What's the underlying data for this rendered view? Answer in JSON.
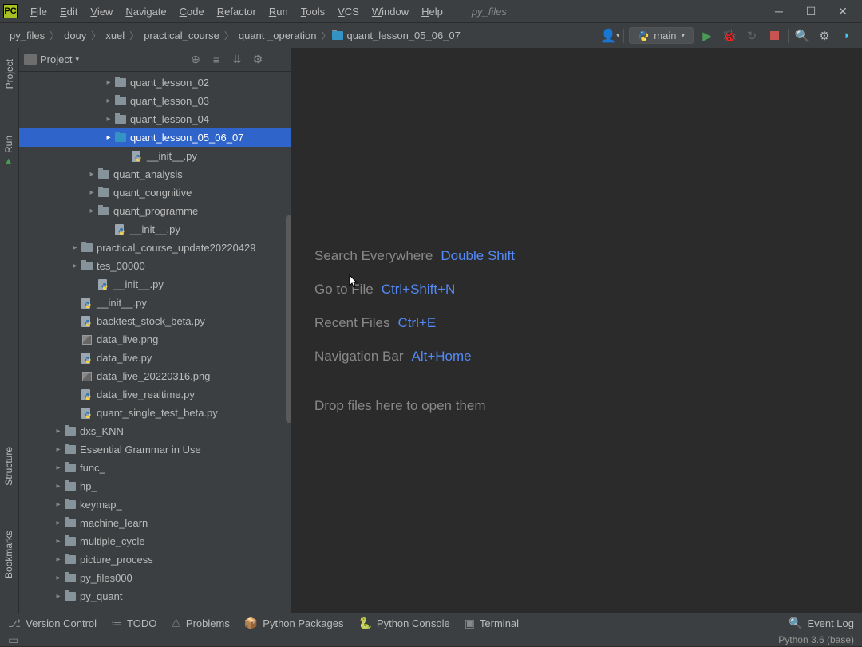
{
  "menus": [
    "File",
    "Edit",
    "View",
    "Navigate",
    "Code",
    "Refactor",
    "Run",
    "Tools",
    "VCS",
    "Window",
    "Help"
  ],
  "projectName": "py_files",
  "breadcrumb": [
    "py_files",
    "douy",
    "xuel",
    "practical_course",
    "quant _operation",
    "quant_lesson_05_06_07"
  ],
  "runConfig": "main",
  "panelTitle": "Project",
  "tree": [
    {
      "d": 5,
      "t": "f",
      "a": "r",
      "n": "quant_lesson_02"
    },
    {
      "d": 5,
      "t": "f",
      "a": "r",
      "n": "quant_lesson_03"
    },
    {
      "d": 5,
      "t": "f",
      "a": "r",
      "n": "quant_lesson_04"
    },
    {
      "d": 5,
      "t": "f",
      "a": "r",
      "n": "quant_lesson_05_06_07",
      "sel": true,
      "blue": true
    },
    {
      "d": 6,
      "t": "py",
      "a": "",
      "n": "__init__.py"
    },
    {
      "d": 4,
      "t": "f",
      "a": "r",
      "n": "quant_analysis"
    },
    {
      "d": 4,
      "t": "f",
      "a": "r",
      "n": "quant_congnitive"
    },
    {
      "d": 4,
      "t": "f",
      "a": "r",
      "n": "quant_programme"
    },
    {
      "d": 5,
      "t": "py",
      "a": "",
      "n": "__init__.py"
    },
    {
      "d": 3,
      "t": "f",
      "a": "r",
      "n": "practical_course_update20220429"
    },
    {
      "d": 3,
      "t": "f",
      "a": "r",
      "n": "tes_00000"
    },
    {
      "d": 4,
      "t": "py",
      "a": "",
      "n": "__init__.py"
    },
    {
      "d": 3,
      "t": "py",
      "a": "",
      "n": "__init__.py"
    },
    {
      "d": 3,
      "t": "py",
      "a": "",
      "n": "backtest_stock_beta.py"
    },
    {
      "d": 3,
      "t": "img",
      "a": "",
      "n": "data_live.png"
    },
    {
      "d": 3,
      "t": "py",
      "a": "",
      "n": "data_live.py"
    },
    {
      "d": 3,
      "t": "img",
      "a": "",
      "n": "data_live_20220316.png"
    },
    {
      "d": 3,
      "t": "py",
      "a": "",
      "n": "data_live_realtime.py"
    },
    {
      "d": 3,
      "t": "py",
      "a": "",
      "n": "quant_single_test_beta.py"
    },
    {
      "d": 2,
      "t": "f",
      "a": "r",
      "n": "dxs_KNN"
    },
    {
      "d": 2,
      "t": "f",
      "a": "r",
      "n": "Essential Grammar in Use"
    },
    {
      "d": 2,
      "t": "f",
      "a": "r",
      "n": "func_"
    },
    {
      "d": 2,
      "t": "f",
      "a": "r",
      "n": "hp_"
    },
    {
      "d": 2,
      "t": "f",
      "a": "r",
      "n": "keymap_"
    },
    {
      "d": 2,
      "t": "f",
      "a": "r",
      "n": "machine_learn"
    },
    {
      "d": 2,
      "t": "f",
      "a": "r",
      "n": "multiple_cycle"
    },
    {
      "d": 2,
      "t": "f",
      "a": "r",
      "n": "picture_process"
    },
    {
      "d": 2,
      "t": "f",
      "a": "r",
      "n": "py_files000"
    },
    {
      "d": 2,
      "t": "f",
      "a": "r",
      "n": "py_quant"
    }
  ],
  "sideTabs": {
    "project": "Project",
    "structure": "Structure",
    "bookmarks": "Bookmarks"
  },
  "runLabel": "Run",
  "hints": [
    {
      "l": "Search Everywhere",
      "s": "Double Shift"
    },
    {
      "l": "Go to File",
      "s": "Ctrl+Shift+N"
    },
    {
      "l": "Recent Files",
      "s": "Ctrl+E"
    },
    {
      "l": "Navigation Bar",
      "s": "Alt+Home"
    }
  ],
  "dropHint": "Drop files here to open them",
  "status": {
    "vc": "Version Control",
    "todo": "TODO",
    "prob": "Problems",
    "pkg": "Python Packages",
    "con": "Python Console",
    "term": "Terminal",
    "ev": "Event Log",
    "interp": "Python 3.6 (base)"
  }
}
